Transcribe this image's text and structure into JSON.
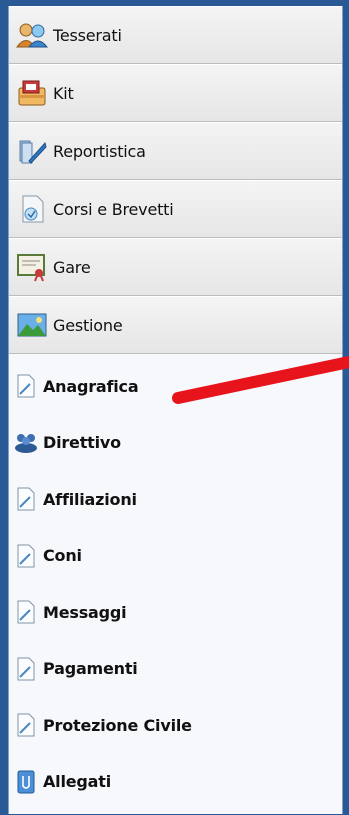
{
  "sections": [
    {
      "label": "Tesserati",
      "icon": "users-icon"
    },
    {
      "label": "Kit",
      "icon": "kit-icon"
    },
    {
      "label": "Reportistica",
      "icon": "report-icon"
    },
    {
      "label": "Corsi e Brevetti",
      "icon": "courses-icon"
    },
    {
      "label": "Gare",
      "icon": "certificate-icon"
    },
    {
      "label": "Gestione",
      "icon": "landscape-icon"
    }
  ],
  "items": [
    {
      "label": "Anagrafica",
      "icon": "document-icon"
    },
    {
      "label": "Direttivo",
      "icon": "group-icon"
    },
    {
      "label": "Affiliazioni",
      "icon": "document-icon"
    },
    {
      "label": "Coni",
      "icon": "document-icon"
    },
    {
      "label": "Messaggi",
      "icon": "document-icon"
    },
    {
      "label": "Pagamenti",
      "icon": "document-icon"
    },
    {
      "label": "Protezione Civile",
      "icon": "document-icon"
    },
    {
      "label": "Allegati",
      "icon": "attachment-icon"
    }
  ],
  "annotation": {
    "arrow_color": "#e8141b"
  }
}
